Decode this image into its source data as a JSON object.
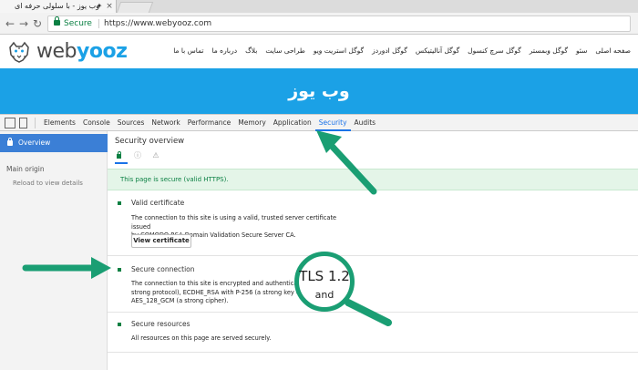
{
  "browser": {
    "tab_title": "وب یوز - با سلولی حرفه ای",
    "tab_close": "×",
    "address_secure_label": "Secure",
    "address_separator": "|",
    "url": "https://www.webyooz.com",
    "back_glyph": "←",
    "forward_glyph": "→",
    "reload_glyph": "↻"
  },
  "site": {
    "logo_web": "web",
    "logo_yooz": "yooz",
    "nav": [
      "صفحه اصلی",
      "سئو",
      "گوگل وبمستر",
      "گوگل سرچ کنسول",
      "گوگل آنالیتیکس",
      "گوگل ادوردز",
      "گوگل استریت ویو",
      "طراحی سایت",
      "بلاگ",
      "درباره ما",
      "تماس با ما"
    ],
    "hero_title": "وب یوز",
    "brand_color": "#1ba1e6"
  },
  "devtools": {
    "tabs": [
      "Elements",
      "Console",
      "Sources",
      "Network",
      "Performance",
      "Memory",
      "Application",
      "Security",
      "Audits"
    ],
    "active_tab": "Security",
    "sidebar": {
      "overview": "Overview",
      "main_origin": "Main origin",
      "reload": "Reload to view details"
    },
    "overview": {
      "title": "Security overview",
      "info_glyph": "ⓘ",
      "warning_glyph": "⚠",
      "banner": "This page is secure (valid HTTPS)."
    },
    "sections": {
      "cert": {
        "title": "Valid certificate",
        "desc_1": "The connection to this site is using a valid, trusted server certificate issued",
        "desc_2": "by COMODO RSA Domain Validation Secure Server CA.",
        "button": "View certificate"
      },
      "conn": {
        "title": "Secure connection",
        "desc_1": "The connection to this site is encrypted and authenticated",
        "desc_2": "strong protocol), ECDHE_RSA with P-256 (a strong key exc",
        "desc_3": "AES_128_GCM (a strong cipher)."
      },
      "res": {
        "title": "Secure resources",
        "desc": "All resources on this page are served securely."
      }
    }
  },
  "annotation": {
    "mag_line1": "TLS 1.2",
    "mag_line2": "and",
    "arrow_color": "#1a9e73"
  }
}
